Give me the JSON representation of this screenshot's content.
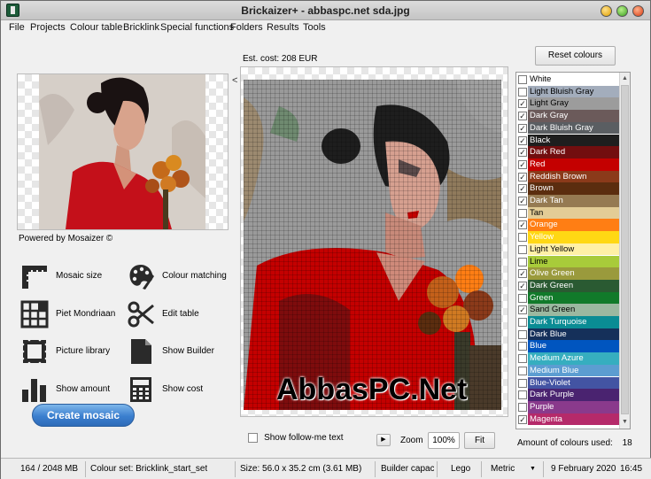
{
  "window": {
    "title": "Brickaizer+  - abbaspc.net sda.jpg"
  },
  "menu": [
    "File",
    "Projects",
    "Colour table",
    "Bricklink",
    "Special functions",
    "Folders",
    "Results",
    "Tools"
  ],
  "left_panel": {
    "powered_by": "Powered by Mosaizer ©",
    "tools": [
      {
        "label": "Mosaic size",
        "icon": "ruler-icon"
      },
      {
        "label": "Colour matching",
        "icon": "palette-icon"
      },
      {
        "label": "Piet Mondriaan",
        "icon": "grid-icon"
      },
      {
        "label": "Edit table",
        "icon": "scissors-icon"
      },
      {
        "label": "Picture library",
        "icon": "stamp-icon"
      },
      {
        "label": "Show Builder",
        "icon": "document-icon"
      },
      {
        "label": "Show amount",
        "icon": "bar-chart-icon"
      },
      {
        "label": "Show cost",
        "icon": "calculator-icon"
      }
    ],
    "create_button": "Create mosaic"
  },
  "preview": {
    "est_cost": "Est. cost: 208 EUR",
    "collapse_arrow": "<",
    "watermark": "AbbasPC.Net",
    "show_follow_me": "Show follow-me text",
    "zoom_label": "Zoom",
    "zoom_value": "100%",
    "fit_button": "Fit"
  },
  "colour_panel": {
    "reset_button": "Reset colours",
    "colours": [
      {
        "name": "White",
        "color": "#ffffff",
        "text": "#000000",
        "checked": false
      },
      {
        "name": "Light Bluish Gray",
        "color": "#a3adbc",
        "text": "#000000",
        "checked": false
      },
      {
        "name": "Light Gray",
        "color": "#9c9c9c",
        "text": "#000000",
        "checked": true
      },
      {
        "name": "Dark Gray",
        "color": "#6b5a5a",
        "text": "#ffffff",
        "checked": true
      },
      {
        "name": "Dark Bluish Gray",
        "color": "#5a5e62",
        "text": "#ffffff",
        "checked": true
      },
      {
        "name": "Black",
        "color": "#1e1e1e",
        "text": "#ffffff",
        "checked": true
      },
      {
        "name": "Dark Red",
        "color": "#720e0f",
        "text": "#ffffff",
        "checked": true
      },
      {
        "name": "Red",
        "color": "#c40000",
        "text": "#ffffff",
        "checked": true
      },
      {
        "name": "Reddish Brown",
        "color": "#8b3a1a",
        "text": "#ffffff",
        "checked": true
      },
      {
        "name": "Brown",
        "color": "#5b2d0f",
        "text": "#ffffff",
        "checked": true
      },
      {
        "name": "Dark Tan",
        "color": "#967a52",
        "text": "#ffffff",
        "checked": true
      },
      {
        "name": "Tan",
        "color": "#e3cc96",
        "text": "#000000",
        "checked": false
      },
      {
        "name": "Orange",
        "color": "#ff7e14",
        "text": "#ffffff",
        "checked": true
      },
      {
        "name": "Yellow",
        "color": "#ffd814",
        "text": "#ffffff",
        "checked": false
      },
      {
        "name": "Light Yellow",
        "color": "#fff0a6",
        "text": "#000000",
        "checked": false
      },
      {
        "name": "Lime",
        "color": "#a8cb3a",
        "text": "#000000",
        "checked": false
      },
      {
        "name": "Olive Green",
        "color": "#9a9a3c",
        "text": "#ffffff",
        "checked": true
      },
      {
        "name": "Dark Green",
        "color": "#2a5a32",
        "text": "#ffffff",
        "checked": true
      },
      {
        "name": "Green",
        "color": "#117a2a",
        "text": "#ffffff",
        "checked": false
      },
      {
        "name": "Sand Green",
        "color": "#9bb8a0",
        "text": "#000000",
        "checked": true
      },
      {
        "name": "Dark Turquoise",
        "color": "#0a8c94",
        "text": "#ffffff",
        "checked": false
      },
      {
        "name": "Dark Blue",
        "color": "#15305a",
        "text": "#ffffff",
        "checked": false
      },
      {
        "name": "Blue",
        "color": "#0055bf",
        "text": "#ffffff",
        "checked": false
      },
      {
        "name": "Medium Azure",
        "color": "#36aebf",
        "text": "#ffffff",
        "checked": false
      },
      {
        "name": "Medium Blue",
        "color": "#5c9dd1",
        "text": "#ffffff",
        "checked": false
      },
      {
        "name": "Blue-Violet",
        "color": "#4354a3",
        "text": "#ffffff",
        "checked": false
      },
      {
        "name": "Dark Purple",
        "color": "#4a2370",
        "text": "#ffffff",
        "checked": false
      },
      {
        "name": "Purple",
        "color": "#8a3a8c",
        "text": "#ffffff",
        "checked": false
      },
      {
        "name": "Magenta",
        "color": "#b52a6a",
        "text": "#ffffff",
        "checked": true
      }
    ],
    "amount_label": "Amount of colours used:",
    "amount_value": "18"
  },
  "statusbar": {
    "memory": "164 / 2048 MB",
    "colour_set": "Colour set: Bricklink_start_set",
    "size": "Size: 56.0 x 35.2 cm (3.61 MB)",
    "builder": "Builder capaci",
    "lego": "Lego",
    "metric": "Metric",
    "date": "9 February 2020",
    "time": "16:45"
  }
}
